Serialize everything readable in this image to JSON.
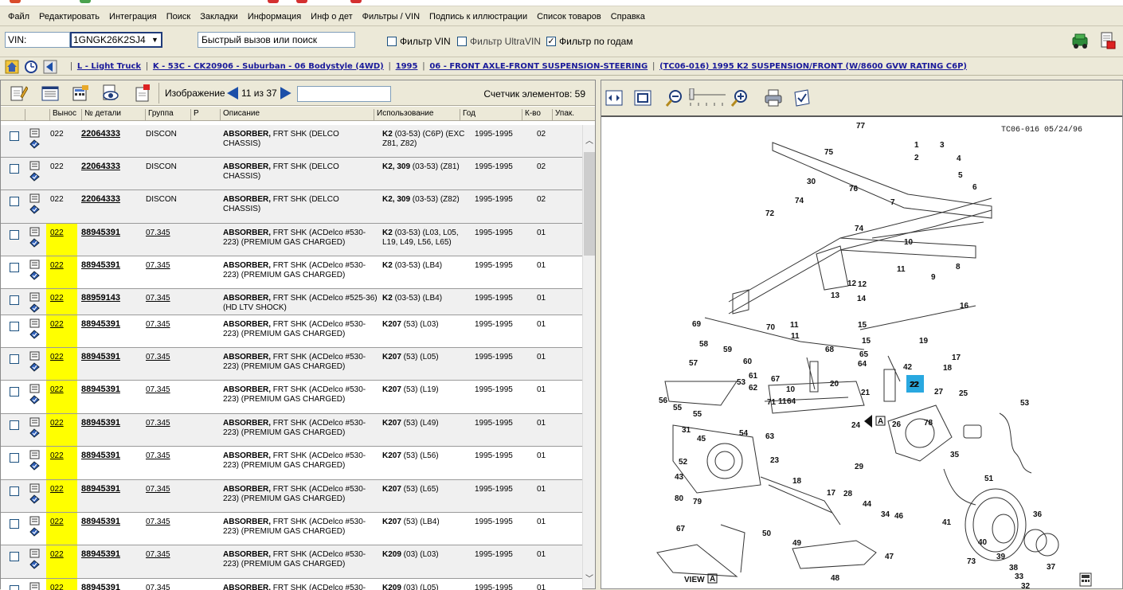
{
  "menu": {
    "items": [
      "Файл",
      "Редактировать",
      "Интеграция",
      "Поиск",
      "Закладки",
      "Информация",
      "Инф о дет",
      "Фильтры / VIN",
      "Подпись к иллюстрации",
      "Список товаров",
      "Справка"
    ]
  },
  "vin": {
    "label": "VIN:",
    "value": "1GNGK26K2SJ4",
    "quick_search": "Быстрый вызов или поиск",
    "filter_vin": "Фильтр VIN",
    "filter_ultravin": "Фильтр UltraVIN",
    "filter_years": "Фильтр по годам",
    "filter_vin_checked": false,
    "filter_ultravin_checked": false,
    "filter_years_checked": true
  },
  "breadcrumb": {
    "items": [
      "L - Light Truck",
      "K - 53C - CK20906 - Suburban - 06 Bodystyle (4WD)",
      "1995",
      "06 - FRONT AXLE-FRONT SUSPENSION-STEERING",
      "(TC06-016) 1995 K2 SUSPENSION/FRONT (W/8600 GVW RATING C6P)"
    ]
  },
  "parts_toolbar": {
    "image_label": "Изображение",
    "page_text": "11 из 37",
    "counter": "Счетчик элементов: 59"
  },
  "columns": {
    "callout": "Вынос",
    "part_no": "№ детали",
    "group": "Группа",
    "p": "Р",
    "desc": "Описание",
    "usage": "Использование",
    "year": "Год",
    "qty": "К-во",
    "pack": "Упак."
  },
  "rows": [
    {
      "callout": "022",
      "part": "22064333",
      "group": "DISCON",
      "desc_b": "ABSORBER,",
      "desc": " FRT SHK (DELCO CHASSIS)",
      "use_b": "K2",
      "use": " (03-53) (C6P) (EXC Z81, Z82)",
      "year": "1995-1995",
      "qty": "02"
    },
    {
      "callout": "022",
      "part": "22064333",
      "group": "DISCON",
      "desc_b": "ABSORBER,",
      "desc": " FRT SHK (DELCO CHASSIS)",
      "use_b": "K2, 309",
      "use": " (03-53) (Z81)",
      "year": "1995-1995",
      "qty": "02"
    },
    {
      "callout": "022",
      "part": "22064333",
      "group": "DISCON",
      "desc_b": "ABSORBER,",
      "desc": " FRT SHK (DELCO CHASSIS)",
      "use_b": "K2, 309",
      "use": " (03-53) (Z82)",
      "year": "1995-1995",
      "qty": "02"
    },
    {
      "callout": "022",
      "part": "88945391",
      "group": "07.345",
      "desc_b": "ABSORBER,",
      "desc": " FRT SHK (ACDelco #530-223) (PREMIUM GAS CHARGED)",
      "use_b": "K2",
      "use": " (03-53) (L03, L05, L19, L49, L56, L65)",
      "year": "1995-1995",
      "qty": "01"
    },
    {
      "callout": "022",
      "part": "88945391",
      "group": "07.345",
      "desc_b": "ABSORBER,",
      "desc": " FRT SHK (ACDelco #530-223) (PREMIUM GAS CHARGED)",
      "use_b": "K2",
      "use": " (03-53) (LB4)",
      "year": "1995-1995",
      "qty": "01"
    },
    {
      "callout": "022",
      "part": "88959143",
      "group": "07.345",
      "desc_b": "ABSORBER,",
      "desc": " FRT SHK (ACDelco #525-36) (HD LTV SHOCK)",
      "use_b": "K2",
      "use": " (03-53) (LB4)",
      "year": "1995-1995",
      "qty": "01"
    },
    {
      "callout": "022",
      "part": "88945391",
      "group": "07.345",
      "desc_b": "ABSORBER,",
      "desc": " FRT SHK (ACDelco #530-223) (PREMIUM GAS CHARGED)",
      "use_b": "K207",
      "use": " (53) (L03)",
      "year": "1995-1995",
      "qty": "01"
    },
    {
      "callout": "022",
      "part": "88945391",
      "group": "07.345",
      "desc_b": "ABSORBER,",
      "desc": " FRT SHK (ACDelco #530-223) (PREMIUM GAS CHARGED)",
      "use_b": "K207",
      "use": " (53) (L05)",
      "year": "1995-1995",
      "qty": "01"
    },
    {
      "callout": "022",
      "part": "88945391",
      "group": "07.345",
      "desc_b": "ABSORBER,",
      "desc": " FRT SHK (ACDelco #530-223) (PREMIUM GAS CHARGED)",
      "use_b": "K207",
      "use": " (53) (L19)",
      "year": "1995-1995",
      "qty": "01"
    },
    {
      "callout": "022",
      "part": "88945391",
      "group": "07.345",
      "desc_b": "ABSORBER,",
      "desc": " FRT SHK (ACDelco #530-223) (PREMIUM GAS CHARGED)",
      "use_b": "K207",
      "use": " (53) (L49)",
      "year": "1995-1995",
      "qty": "01"
    },
    {
      "callout": "022",
      "part": "88945391",
      "group": "07.345",
      "desc_b": "ABSORBER,",
      "desc": " FRT SHK (ACDelco #530-223) (PREMIUM GAS CHARGED)",
      "use_b": "K207",
      "use": " (53) (L56)",
      "year": "1995-1995",
      "qty": "01"
    },
    {
      "callout": "022",
      "part": "88945391",
      "group": "07.345",
      "desc_b": "ABSORBER,",
      "desc": " FRT SHK (ACDelco #530-223) (PREMIUM GAS CHARGED)",
      "use_b": "K207",
      "use": " (53) (L65)",
      "year": "1995-1995",
      "qty": "01"
    },
    {
      "callout": "022",
      "part": "88945391",
      "group": "07.345",
      "desc_b": "ABSORBER,",
      "desc": " FRT SHK (ACDelco #530-223) (PREMIUM GAS CHARGED)",
      "use_b": "K207",
      "use": " (53) (LB4)",
      "year": "1995-1995",
      "qty": "01"
    },
    {
      "callout": "022",
      "part": "88945391",
      "group": "07.345",
      "desc_b": "ABSORBER,",
      "desc": " FRT SHK (ACDelco #530-223) (PREMIUM GAS CHARGED)",
      "use_b": "K209",
      "use": " (03) (L03)",
      "year": "1995-1995",
      "qty": "01"
    },
    {
      "callout": "022",
      "part": "88945391",
      "group": "07.345",
      "desc_b": "ABSORBER,",
      "desc": " FRT SHK (ACDelco #530-223) (PREMIUM GAS CHARGED)",
      "use_b": "K209",
      "use": " (03) (L05)",
      "year": "1995-1995",
      "qty": "01"
    }
  ],
  "diagram": {
    "header": "TC06-016 05/24/96",
    "view_label": "VIEW",
    "view_letter": "A",
    "highlighted_callout": "22",
    "callouts": [
      "77",
      "1",
      "2",
      "3",
      "4",
      "5",
      "6",
      "75",
      "30",
      "76",
      "7",
      "74",
      "72",
      "74",
      "10",
      "11",
      "8",
      "9",
      "12",
      "13",
      "14",
      "15",
      "16",
      "69",
      "70",
      "11",
      "11",
      "58",
      "59",
      "68",
      "60",
      "65",
      "64",
      "42",
      "18",
      "17",
      "19",
      "15",
      "57",
      "61",
      "62",
      "53",
      "71",
      "67",
      "10",
      "20",
      "21",
      "22",
      "56",
      "55",
      "55",
      "54",
      "31",
      "45",
      "63",
      "11",
      "64",
      "23",
      "24",
      "29",
      "26",
      "27",
      "25",
      "78",
      "53",
      "52",
      "43",
      "18",
      "17",
      "28",
      "35",
      "51",
      "80",
      "79",
      "50",
      "49",
      "44",
      "34",
      "46",
      "41",
      "36",
      "67",
      "47",
      "48",
      "73",
      "40",
      "39",
      "38",
      "37",
      "33",
      "32",
      "12"
    ]
  },
  "colors": {
    "highlight_yellow": "#ffff00",
    "link_blue": "#1a1a9a",
    "callout_highlight": "#29a8e0"
  }
}
